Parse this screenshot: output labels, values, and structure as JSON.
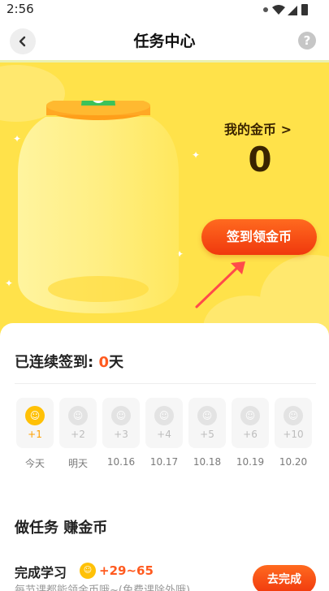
{
  "status_bar": {
    "time": "2:56"
  },
  "header": {
    "title": "任务中心",
    "help_glyph": "?"
  },
  "hero": {
    "coins_label": "我的金币 >",
    "coins_value": "0",
    "checkin_button": "签到领金币"
  },
  "streak": {
    "prefix": "已连续签到: ",
    "count": "0",
    "suffix": "天"
  },
  "days": [
    {
      "amount": "+1",
      "label": "今天",
      "active": true
    },
    {
      "amount": "+2",
      "label": "明天",
      "active": false
    },
    {
      "amount": "+3",
      "label": "10.16",
      "active": false
    },
    {
      "amount": "+4",
      "label": "10.17",
      "active": false
    },
    {
      "amount": "+5",
      "label": "10.18",
      "active": false
    },
    {
      "amount": "+6",
      "label": "10.19",
      "active": false
    },
    {
      "amount": "+10",
      "label": "10.20",
      "active": false
    }
  ],
  "tasks_section": {
    "title": "做任务  赚金币",
    "task": {
      "name": "完成学习",
      "reward": "+29~65",
      "description": "每节课都能领金币哦~(免费课除外哦)",
      "button": "去完成"
    }
  },
  "colors": {
    "accent": "#ff5a1f",
    "hero_bg": "#ffe24a",
    "coin_gold": "#ffc107",
    "dark_text": "#3a2400"
  }
}
